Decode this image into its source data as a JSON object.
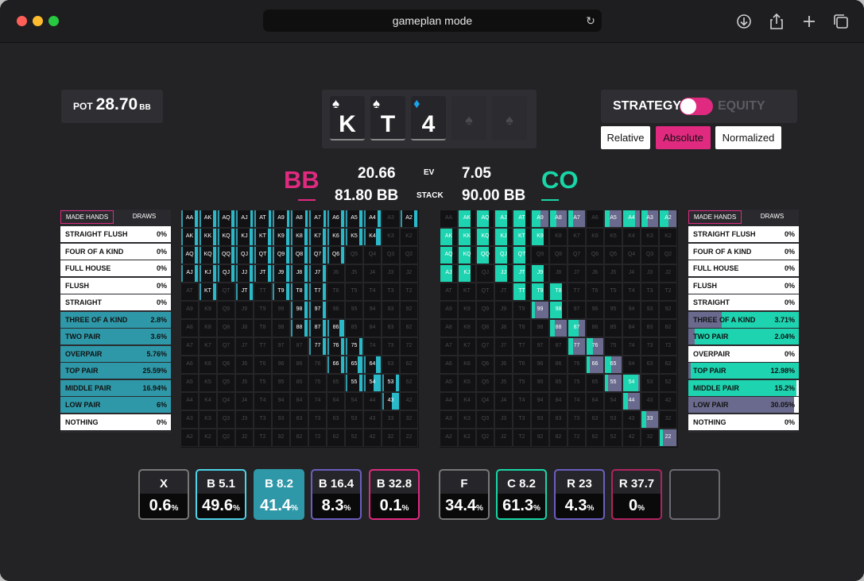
{
  "window": {
    "title": "gameplan mode"
  },
  "pot": {
    "label": "POT",
    "value": "28.70",
    "unit": "BB"
  },
  "board": [
    {
      "rank": "K",
      "suit": "♠",
      "suit_color": "#ffffff"
    },
    {
      "rank": "T",
      "suit": "♠",
      "suit_color": "#ffffff"
    },
    {
      "rank": "4",
      "suit": "♦",
      "suit_color": "#1aa3e8"
    },
    {
      "rank": "",
      "suit": "♠",
      "empty": true
    },
    {
      "rank": "",
      "suit": "♠",
      "empty": true
    }
  ],
  "view": {
    "strategy_label": "STRATEGY",
    "equity_label": "EQUITY",
    "modes": [
      "Relative",
      "Absolute",
      "Normalized"
    ],
    "active_mode": "Absolute"
  },
  "players": {
    "left": {
      "name": "BB",
      "color": "#df2a80",
      "ev": "20.66",
      "stack": "81.80 BB"
    },
    "right": {
      "name": "CO",
      "color": "#19d6a6",
      "ev": "7.05",
      "stack": "90.00 BB"
    },
    "ev_label": "EV",
    "stack_label": "STACK"
  },
  "colors": {
    "bb_check": "#2f98a8",
    "bb_bet": "#29b9c9",
    "co_call": "#1dd3b0",
    "co_raise": "#6a6a8e",
    "accent": "#df2a80"
  },
  "category_tabs": [
    "MADE HANDS",
    "DRAWS"
  ],
  "left_categories": [
    {
      "name": "STRAIGHT FLUSH",
      "pct": "0%",
      "fill": 0
    },
    {
      "name": "FOUR OF A KIND",
      "pct": "0%",
      "fill": 0
    },
    {
      "name": "FULL HOUSE",
      "pct": "0%",
      "fill": 0
    },
    {
      "name": "FLUSH",
      "pct": "0%",
      "fill": 0
    },
    {
      "name": "STRAIGHT",
      "pct": "0%",
      "fill": 0
    },
    {
      "name": "THREE OF A KIND",
      "pct": "2.8%",
      "fill": 1
    },
    {
      "name": "TWO PAIR",
      "pct": "3.6%",
      "fill": 1
    },
    {
      "name": "OVERPAIR",
      "pct": "5.76%",
      "fill": 1
    },
    {
      "name": "TOP PAIR",
      "pct": "25.59%",
      "fill": 1
    },
    {
      "name": "MIDDLE PAIR",
      "pct": "16.94%",
      "fill": 1
    },
    {
      "name": "LOW PAIR",
      "pct": "6%",
      "fill": 1
    },
    {
      "name": "NOTHING",
      "pct": "0%",
      "fill": 0
    }
  ],
  "right_categories": [
    {
      "name": "STRAIGHT FLUSH",
      "pct": "0%",
      "raise": 0,
      "call": 0
    },
    {
      "name": "FOUR OF A KIND",
      "pct": "0%",
      "raise": 0,
      "call": 0
    },
    {
      "name": "FULL HOUSE",
      "pct": "0%",
      "raise": 0,
      "call": 0
    },
    {
      "name": "FLUSH",
      "pct": "0%",
      "raise": 0,
      "call": 0
    },
    {
      "name": "STRAIGHT",
      "pct": "0%",
      "raise": 0,
      "call": 0
    },
    {
      "name": "THREE OF A KIND",
      "pct": "3.71%",
      "raise": 0.3,
      "call": 0.7
    },
    {
      "name": "TWO PAIR",
      "pct": "2.04%",
      "raise": 0.06,
      "call": 0.94
    },
    {
      "name": "OVERPAIR",
      "pct": "0%",
      "raise": 0,
      "call": 0
    },
    {
      "name": "TOP PAIR",
      "pct": "12.98%",
      "raise": 0.02,
      "call": 0.98
    },
    {
      "name": "MIDDLE PAIR",
      "pct": "15.2%",
      "raise": 0,
      "call": 0.98
    },
    {
      "name": "LOW PAIR",
      "pct": "30.05%",
      "raise": 0.96,
      "call": 0
    },
    {
      "name": "NOTHING",
      "pct": "0%",
      "raise": 0,
      "call": 0
    }
  ],
  "ranks": [
    "A",
    "K",
    "Q",
    "J",
    "T",
    "9",
    "8",
    "7",
    "6",
    "5",
    "4",
    "3",
    "2"
  ],
  "left_range": {
    "AA": [
      0.1,
      0.2
    ],
    "AK": [
      0.1,
      0.2
    ],
    "AQ": [
      0.1,
      0.2
    ],
    "AJ": [
      0.1,
      0.15
    ],
    "AT": [
      0.1,
      0.15
    ],
    "A9": [
      0.1,
      0.15
    ],
    "A8": [
      0.1,
      0.15
    ],
    "A7": [
      0.1,
      0.15
    ],
    "A6": [
      0.1,
      0.2
    ],
    "A5": [
      0.1,
      0.2
    ],
    "A4": [
      0.1,
      0.2
    ],
    "A3": [
      0,
      0
    ],
    "A2": [
      0.1,
      0.2
    ],
    "AKo": [
      0.1,
      0.2
    ],
    "KK": [
      0.1,
      0.2
    ],
    "KQ": [
      0.1,
      0.2
    ],
    "KJ": [
      0.1,
      0.2
    ],
    "KT": [
      0.1,
      0.2
    ],
    "K9": [
      0.1,
      0.2
    ],
    "K8": [
      0.1,
      0.2
    ],
    "K7": [
      0.1,
      0.2
    ],
    "K6": [
      0.1,
      0.2
    ],
    "K5": [
      0.1,
      0.2
    ],
    "K4": [
      0.1,
      0.3
    ],
    "AQo": [
      0.1,
      0.2
    ],
    "KQo": [
      0.1,
      0.2
    ],
    "QQ": [
      0.1,
      0.2
    ],
    "QJ": [
      0.1,
      0.2
    ],
    "QT": [
      0.1,
      0.2
    ],
    "Q9": [
      0.1,
      0.2
    ],
    "Q8": [
      0.1,
      0.2
    ],
    "Q7": [
      0.1,
      0.2
    ],
    "Q6": [
      0.1,
      0.2
    ],
    "AJo": [
      0.1,
      0.2
    ],
    "KJo": [
      0.1,
      0.2
    ],
    "QJo": [
      0.1,
      0.2
    ],
    "JJ": [
      0.1,
      0.2
    ],
    "JT": [
      0.1,
      0.2
    ],
    "J9": [
      0.1,
      0.2
    ],
    "J8": [
      0.1,
      0.2
    ],
    "J7": [
      0.1,
      0.2
    ],
    "ATo": [
      0,
      0
    ],
    "KTo": [
      0.1,
      0.2
    ],
    "QTo": [
      0,
      0
    ],
    "JTo": [
      0.1,
      0.2
    ],
    "TT": [
      0,
      0
    ],
    "T9": [
      0.1,
      0.2
    ],
    "T8": [
      0.1,
      0.2
    ],
    "T7": [
      0.1,
      0.2
    ],
    "99": [
      0,
      0
    ],
    "98": [
      0.1,
      0.2
    ],
    "97": [
      0.1,
      0.2
    ],
    "88": [
      0.1,
      0.2
    ],
    "87": [
      0.1,
      0.2
    ],
    "86": [
      0.1,
      0.3
    ],
    "77": [
      0.1,
      0.2
    ],
    "76": [
      0.1,
      0.2
    ],
    "75": [
      0.1,
      0.2
    ],
    "66": [
      0.1,
      0.2
    ],
    "65": [
      0.1,
      0.3
    ],
    "64": [
      0.1,
      0.3
    ],
    "55": [
      0.1,
      0.2
    ],
    "54": [
      0.1,
      0.45
    ],
    "53": [
      0.1,
      0.2
    ],
    "43": [
      0.1,
      0.45
    ]
  },
  "right_range": {
    "AK": [
      0.7,
      0
    ],
    "AQ": [
      0.7,
      0
    ],
    "AJ": [
      0.7,
      0
    ],
    "AT": [
      0.7,
      0
    ],
    "A9": [
      0.5,
      0.5
    ],
    "A8": [
      0.4,
      0.6
    ],
    "A7": [
      0.3,
      0.7
    ],
    "A5": [
      0.3,
      0.7
    ],
    "A4": [
      0.7,
      0.3
    ],
    "A3": [
      0.4,
      0.6
    ],
    "A2": [
      0.5,
      0.5
    ],
    "AKo": [
      0.7,
      0
    ],
    "KK": [
      0.7,
      0
    ],
    "KQ": [
      0.7,
      0
    ],
    "KJ": [
      0.7,
      0
    ],
    "KT": [
      0.7,
      0
    ],
    "K9": [
      0.7,
      0
    ],
    "AQo": [
      0.7,
      0
    ],
    "KQo": [
      0.7,
      0
    ],
    "QQ": [
      0.7,
      0
    ],
    "QJ": [
      0.7,
      0
    ],
    "QT": [
      0.7,
      0
    ],
    "AJo": [
      0.7,
      0
    ],
    "KJo": [
      0.7,
      0
    ],
    "JJ": [
      0.7,
      0
    ],
    "JT": [
      0.7,
      0
    ],
    "J9": [
      0.7,
      0
    ],
    "TT": [
      0.7,
      0
    ],
    "T9": [
      0.7,
      0
    ],
    "T8": [
      0.7,
      0
    ],
    "99": [
      0.2,
      0.8
    ],
    "98": [
      0.7,
      0
    ],
    "88": [
      0.3,
      0.7
    ],
    "87": [
      0.6,
      0.4
    ],
    "77": [
      0.3,
      0.7
    ],
    "76": [
      0.4,
      0.6
    ],
    "66": [
      0.2,
      0.8
    ],
    "65": [
      0.4,
      0.6
    ],
    "55": [
      0.2,
      0.8
    ],
    "54": [
      0.9,
      0.1
    ],
    "44": [
      0.3,
      0.7
    ],
    "33": [
      0.3,
      0.7
    ],
    "22": [
      0.2,
      0.8
    ]
  },
  "bb_actions": [
    {
      "label": "X",
      "pct": "0.6",
      "border": "#777777"
    },
    {
      "label": "B 5.1",
      "pct": "49.6",
      "border": "#4fd3e8"
    },
    {
      "label": "B 8.2",
      "pct": "41.4",
      "border": "#2f98a8",
      "selected": true
    },
    {
      "label": "B 16.4",
      "pct": "8.3",
      "border": "#6a5fc0"
    },
    {
      "label": "B 32.8",
      "pct": "0.1",
      "border": "#df2a80"
    }
  ],
  "co_actions": [
    {
      "label": "F",
      "pct": "34.4",
      "border": "#777777"
    },
    {
      "label": "C 8.2",
      "pct": "61.3",
      "border": "#19d6a6"
    },
    {
      "label": "R 23",
      "pct": "4.3",
      "border": "#6a5fc0"
    },
    {
      "label": "R 37.7",
      "pct": "0",
      "border": "#b0245e"
    },
    {
      "label": "",
      "pct": "",
      "border": "#6a6a72",
      "empty": true
    }
  ],
  "pct_symbol": "%"
}
